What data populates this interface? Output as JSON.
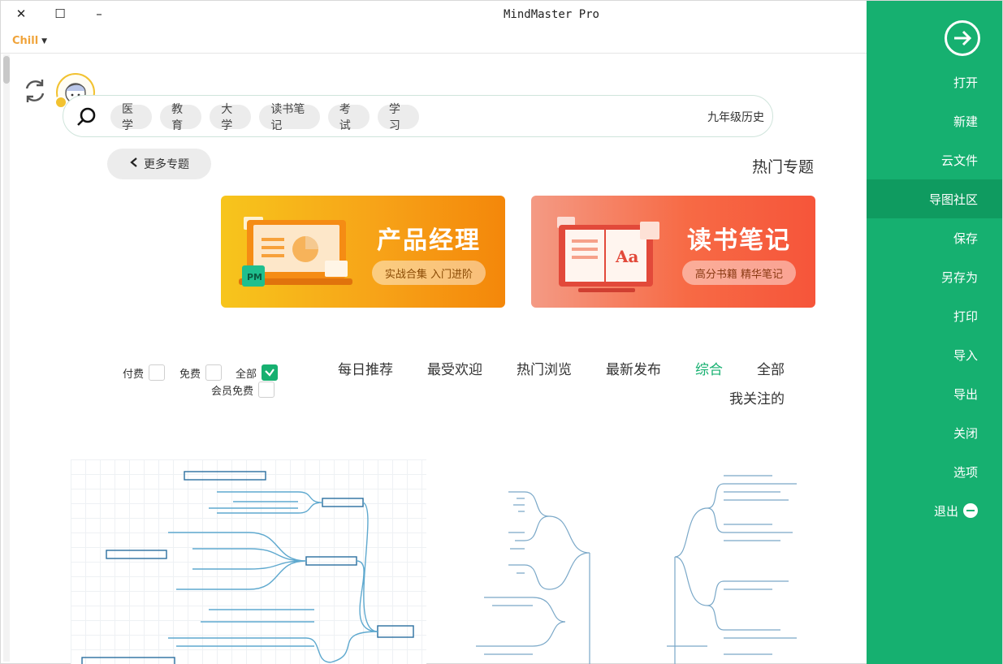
{
  "window": {
    "title": "MindMaster Pro",
    "close": "✕",
    "maximize": "☐",
    "minimize": "–",
    "theme": "Chill"
  },
  "side_menu": {
    "items": [
      {
        "label": "打开"
      },
      {
        "label": "新建"
      },
      {
        "label": "云文件"
      },
      {
        "label": "导图社区",
        "active": true
      },
      {
        "label": "保存"
      },
      {
        "label": "另存为"
      },
      {
        "label": "打印"
      },
      {
        "label": "导入"
      },
      {
        "label": "导出"
      },
      {
        "label": "关闭"
      },
      {
        "label": "选项"
      },
      {
        "label": "退出"
      }
    ],
    "accent": "#16b070"
  },
  "search": {
    "value": "九年级历史",
    "tags": [
      "学习",
      "考试",
      "读书笔记",
      "大学",
      "教育",
      "医学"
    ]
  },
  "section": {
    "title": "热门专题",
    "more": "更多专题"
  },
  "banners": [
    {
      "title": "读书笔记",
      "subtitle": "高分书籍 精华笔记",
      "art_text": "Aa",
      "color": "#f76a45"
    },
    {
      "title": "产品经理",
      "subtitle": "实战合集 入门进阶",
      "art_text": "PM",
      "color": "#f7a318"
    }
  ],
  "filters": {
    "tabs": [
      "全部",
      "综合",
      "最新发布",
      "热门浏览",
      "最受欢迎",
      "每日推荐"
    ],
    "active": "综合",
    "wrap": "我关注的"
  },
  "price_filters": {
    "all": "全部",
    "free": "免费",
    "paid": "付费",
    "member_free": "会员免费",
    "all_checked": true
  }
}
